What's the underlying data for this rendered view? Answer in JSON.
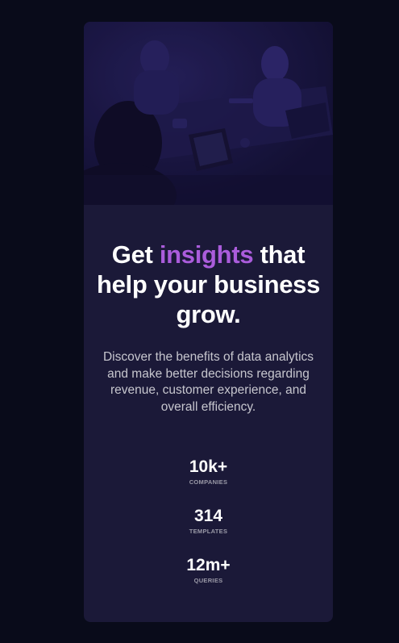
{
  "hero": {
    "image_alt": "people working on laptops"
  },
  "headline": {
    "before": "Get ",
    "accent": "insights",
    "after": " that help your business grow."
  },
  "description": "Discover the benefits of data analytics and make better decisions regarding revenue, customer experience, and overall efficiency.",
  "stats": [
    {
      "value": "10k+",
      "label": "COMPANIES"
    },
    {
      "value": "314",
      "label": "TEMPLATES"
    },
    {
      "value": "12m+",
      "label": "QUERIES"
    }
  ],
  "colors": {
    "page_background": "#090b1a",
    "card_background": "#1b1938",
    "accent": "#aa5cdb"
  }
}
